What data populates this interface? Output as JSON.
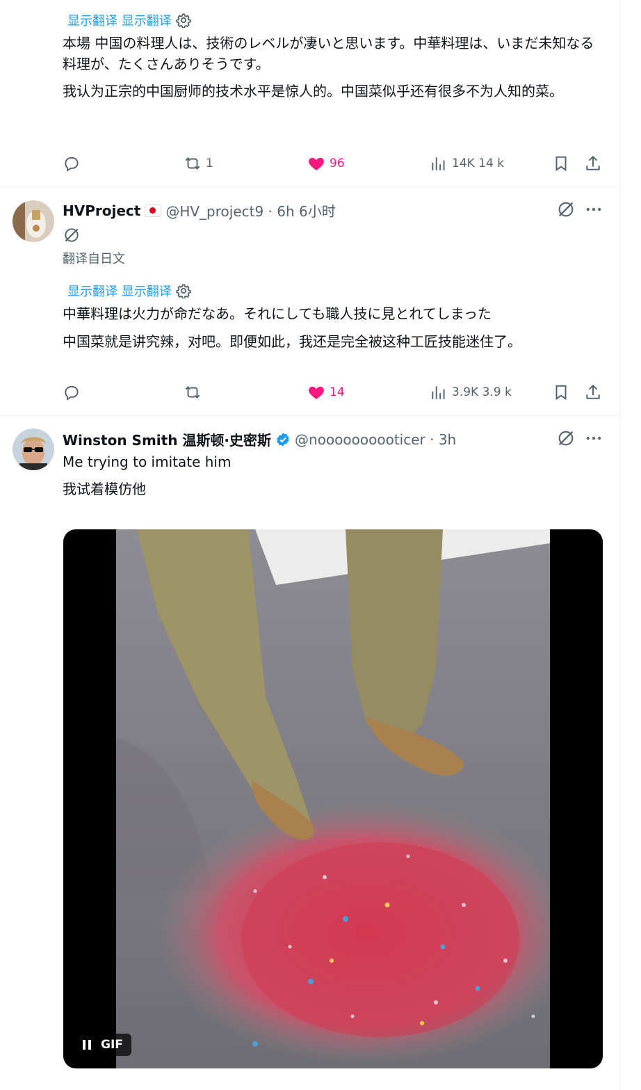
{
  "tweet1": {
    "show_translation": "显示翻译 显示翻译",
    "text_ja": "本場 中国の料理人は、技術のレベルが凄いと思います。中華料理は、いまだ未知なる料理が、たくさんありそうです。",
    "text_zh": "我认为正宗的中国厨师的技术水平是惊人的。中国菜似乎还有很多不为人知的菜。",
    "reposts": "1",
    "likes": "96",
    "views": "14K 14 k"
  },
  "tweet2": {
    "name": "HVProject",
    "handle_time": "@HV_project9 · 6h 6小时",
    "translated_from": "翻译自日文",
    "show_translation": "显示翻译 显示翻译",
    "text_ja": "中華料理は火力が命だなあ。それにしても職人技に見とれてしまった",
    "text_zh": "中国菜就是讲究辣，对吧。即便如此，我还是完全被这种工匠技能迷住了。",
    "likes": "14",
    "views": "3.9K 3.9 k"
  },
  "tweet3": {
    "name": "Winston Smith 温斯顿·史密斯",
    "handle_time": "@noooooooooticer · 3h",
    "text_en": "Me trying to imitate him",
    "text_zh": "我试着模仿他",
    "gif_label": "GIF"
  },
  "icons": [
    "reply-icon",
    "repost-icon",
    "like-icon",
    "views-icon",
    "bookmark-icon",
    "share-icon",
    "grok-icon",
    "more-icon",
    "settings-icon",
    "verified-icon",
    "pause-icon"
  ],
  "colors": {
    "accent": "#1d9bf0",
    "like": "#f91880",
    "muted": "#536471",
    "text": "#0f1419"
  }
}
